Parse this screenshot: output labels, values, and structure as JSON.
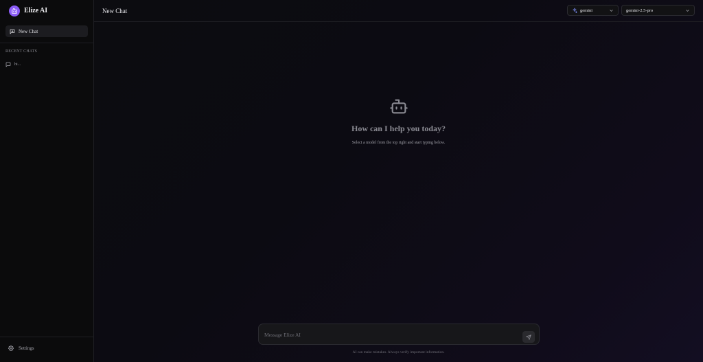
{
  "brand": {
    "name": "Elize AI",
    "logo_icon": "bot-icon",
    "accent": "#8b5cf6"
  },
  "sidebar": {
    "new_chat_label": "New Chat",
    "recent_title": "RECENT CHATS",
    "recent_items": [
      {
        "label": "hi..."
      }
    ],
    "settings_label": "Settings"
  },
  "header": {
    "title": "New Chat",
    "provider_select": {
      "value": "gemini",
      "icon": "sparkle-icon"
    },
    "model_select": {
      "value": "gemini-2.5-pro"
    }
  },
  "empty_state": {
    "heading": "How can I help you today?",
    "subtext": "Select a model from the top right and start typing below."
  },
  "composer": {
    "placeholder": "Message Elize AI",
    "disclaimer": "AI can make mistakes. Always verify important information."
  }
}
